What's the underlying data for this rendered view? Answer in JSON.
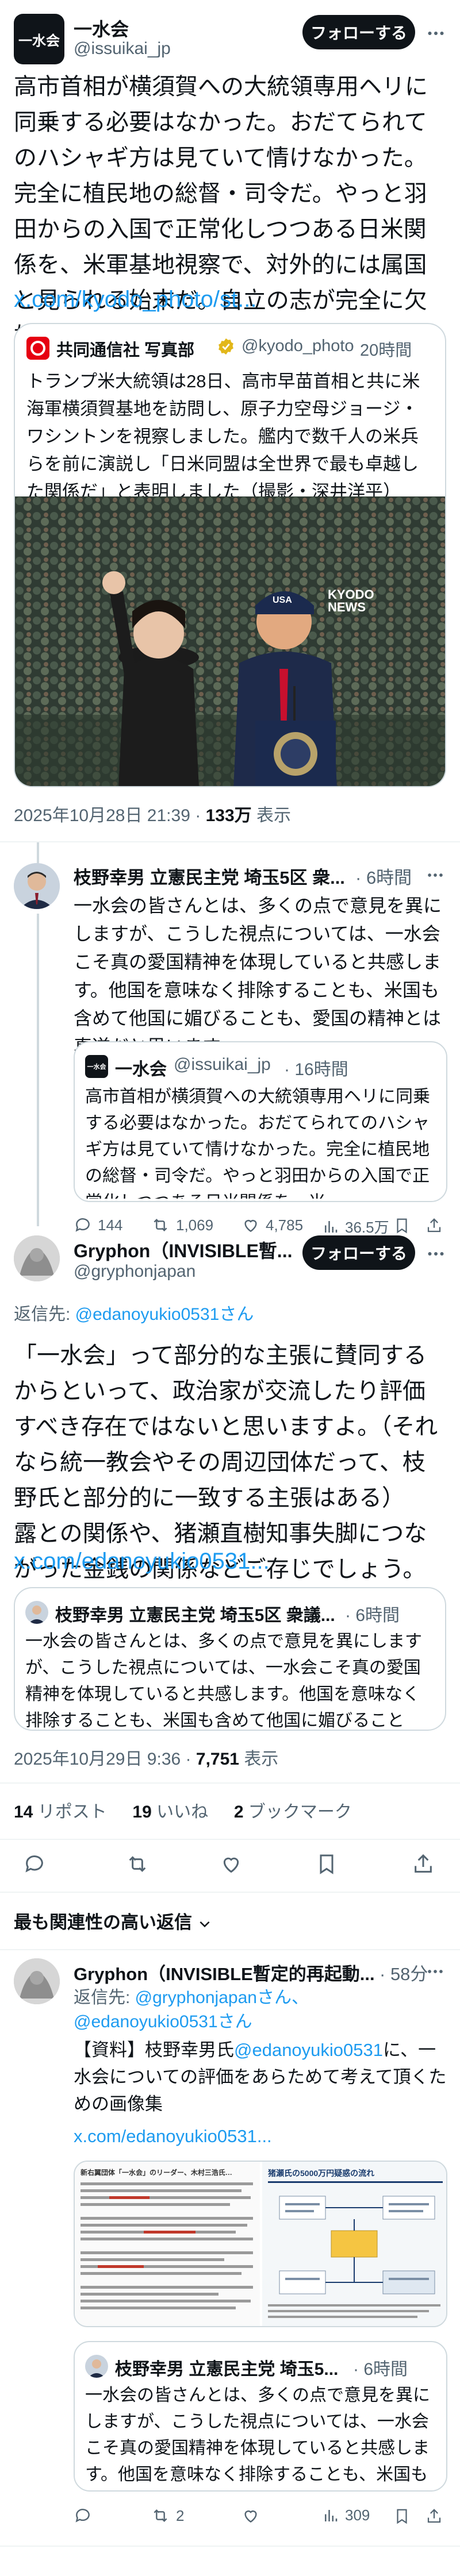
{
  "tweet": {
    "logo_text": "一水会",
    "display_name": "一水会",
    "handle": "@issuikai_jp",
    "follow_label": "フォローする",
    "body": "高市首相が横須賀への大統領専用ヘリに同乗する必要はなかった。おだてられてのハシャギ方は見ていて情けなかった。完全に植民地の総督・司令だ。やっと羽田からの入国で正常化しつつある日米関係を、米軍基地視察で、対外的には属国と見られる始末だ。自立の志が完全に欠如。",
    "link": "x.com/kyodo_photo/st...",
    "timestamp": "2025年10月28日 21:39",
    "dot": "·",
    "views_count": "133万",
    "views_label": "表示"
  },
  "kyodo_quote": {
    "name": "共同通信社 写真部",
    "handle": "@kyodo_photo",
    "time": "20時間",
    "body": "トランプ米大統領は28日、高市早苗首相と共に米海軍横須賀基地を訪問し、原子力空母ジョージ・ワシントンを視察しました。艦内で数千人の米兵らを前に演説し「日米同盟は全世界で最も卓越した関係だ」と表明しました（撮影・深井洋平）",
    "photo_cap": "USA",
    "watermark1": "KYODO",
    "watermark2": "NEWS"
  },
  "edano_reply": {
    "name": "枝野幸男 立憲民主党 埼玉5区 衆...",
    "time": "6時間",
    "body": "一水会の皆さんとは、多くの点で意見を異にしますが、こうした視点については、一水会こそ真の愛国精神を体現していると共感します。他国を意味なく排除することも、米国も含めて他国に媚びることも、愛国の精神とは真逆だと思います。",
    "quote_name": "一水会",
    "quote_handle": "@issuikai_jp",
    "quote_time": "16時間",
    "quote_body": "高市首相が横須賀への大統領専用ヘリに同乗する必要はなかった。おだてられてのハシャギ方は見ていて情けなかった。完全に植民地の総督・司令だ。やっと羽田からの入国で正常化しつつある日米関係を、米...",
    "stats": {
      "replies": "144",
      "retweets": "1,069",
      "likes": "4,785",
      "views": "36.5万"
    }
  },
  "gryphon": {
    "name": "Gryphon（INVISIBLE暫...",
    "handle": "@gryphonjapan",
    "follow_label": "フォローする",
    "reply_to_prefix": "返信先: ",
    "reply_to_handle": "@edanoyukio0531さん",
    "body": "「一水会」って部分的な主張に賛同するからといって、政治家が交流したり評価すべき存在ではないと思いますよ。（それなら統一教会やその周辺団体だって、枝野氏と部分的に一致する主張はある）\n露との関係や、猪瀬直樹知事失脚につながった金銭の関係などご存じでしょう。",
    "link": "x.com/edanoyukio0531...",
    "quote_name": "枝野幸男 立憲民主党 埼玉5区 衆議...",
    "quote_time": "6時間",
    "quote_body": "一水会の皆さんとは、多くの点で意見を異にしますが、こうした視点については、一水会こそ真の愛国精神を体現していると共感します。他国を意味なく排除することも、米国も含めて他国に媚びることも、愛国の精神とは真逆だと思います。",
    "timestamp": "2025年10月29日 9:36",
    "dot": "·",
    "views_count": "7,751",
    "views_label": "表示",
    "retweets_count": "14",
    "retweets_label": "リポスト",
    "likes_count": "19",
    "likes_label": "いいね",
    "bookmarks_count": "2",
    "bookmarks_label": "ブックマーク"
  },
  "relevant_header": "最も関連性の高い返信",
  "reply2": {
    "name": "Gryphon（INVISIBLE暫定的再起動...",
    "time": "58分",
    "reply_to_prefix": "返信先: ",
    "reply_to_handles": "@gryphonjapanさん、@edanoyukio0531さん",
    "body_pre": "【資料】枝野幸男氏",
    "body_mention": "@edanoyukio0531",
    "body_post": "に、一水会についての評価をあらためて考えて頂くための画像集",
    "link": "x.com/edanoyukio0531...",
    "img1_title": "新右翼団体「一水会」のリーダー、木村三浩氏…",
    "img2_title": "猪瀬氏の5000万円疑惑の流れ",
    "quote_name": "枝野幸男 立憲民主党 埼玉5...",
    "quote_time": "6時間",
    "quote_body": "一水会の皆さんとは、多くの点で意見を異にしますが、こうした視点については、一水会こそ真の愛国精神を体現していると共感します。他国を意味なく排除することも、米国も含めて他国に媚びることも、...",
    "stats": {
      "retweets": "2",
      "views": "309"
    }
  }
}
